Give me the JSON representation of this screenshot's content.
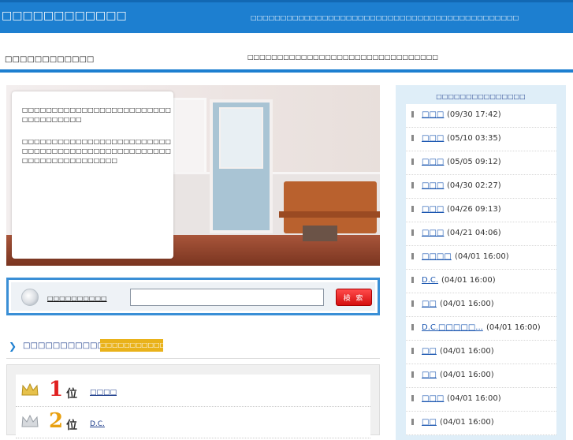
{
  "header": {
    "site_title": "□□□□□□□□□□□□",
    "description": "□□□□□□□□□□□□□□□□□□□□□□□□□□□□□□□□□□□□□□□□□□□□□",
    "sub_left": "□□□□□□□□□□□□",
    "sub_right": "□□□□□□□□□□□□□□□□□□□□□□□□□□□□□□□□"
  },
  "hero": {
    "text1": "□□□□□□□□□□□□□□□□□□□□□□□□□□□□□□□□□□□",
    "text2": "□□□□□□□□□□□□□□□□□□□□□□□□□□□□□□□□□□□□□□□□□□□□□□□□□□□□□□□□□□□□□□□□□□"
  },
  "search": {
    "label": "□□□□□□□□□□",
    "placeholder": "",
    "button_label": "検 索"
  },
  "ranking": {
    "title": "□□□□□□□□□□□□□□□□",
    "badge": "□□□□□□□□□□□□□",
    "rows": [
      {
        "rank": "1",
        "suffix": "位",
        "name": "□□□□",
        "color": "#e02020"
      },
      {
        "rank": "2",
        "suffix": "位",
        "name": "D.C.",
        "color": "#e8a010"
      }
    ]
  },
  "sidebar": {
    "title": "□□□□□□□□□□□□□□□",
    "items": [
      {
        "name": "□□□",
        "date": "(09/30 17:42)"
      },
      {
        "name": "□□□",
        "date": "(05/10 03:35)"
      },
      {
        "name": "□□□",
        "date": "(05/05 09:12)"
      },
      {
        "name": "□□□",
        "date": "(04/30 02:27)"
      },
      {
        "name": "□□□",
        "date": "(04/26 09:13)"
      },
      {
        "name": "□□□",
        "date": "(04/21 04:06)"
      },
      {
        "name": "□□□□",
        "date": "(04/01 16:00)"
      },
      {
        "name": "D.C.",
        "date": "(04/01 16:00)"
      },
      {
        "name": "□□",
        "date": "(04/01 16:00)"
      },
      {
        "name": "D.C.□□□□□...",
        "date": "(04/01 16:00)"
      },
      {
        "name": "□□",
        "date": "(04/01 16:00)"
      },
      {
        "name": "□□",
        "date": "(04/01 16:00)"
      },
      {
        "name": "□□□",
        "date": "(04/01 16:00)"
      },
      {
        "name": "□□",
        "date": "(04/01 16:00)"
      }
    ]
  },
  "colors": {
    "accent": "#1d7fd0",
    "search_button": "#e01515",
    "badge": "#e9b21a"
  }
}
